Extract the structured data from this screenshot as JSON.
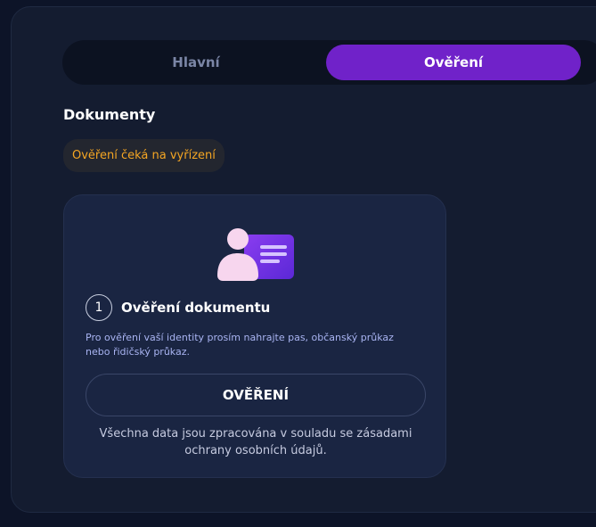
{
  "tabs": [
    {
      "label": "Hlavní",
      "active": false
    },
    {
      "label": "Ověření",
      "active": true
    }
  ],
  "section": {
    "title": "Dokumenty",
    "status_badge": "Ověření čeká na vyřízení"
  },
  "card": {
    "illustration_icon": "id-card-icon",
    "step_number": "1",
    "step_title": "Ověření dokumentu",
    "description_line1": "Pro ověření vaší identity prosím nahrajte pas, občanský průkaz",
    "description_line2": "nebo řidičský průkaz.",
    "button_label": "OVĚŘENÍ",
    "footnote_line1": "Všechna data jsou zpracována v souladu se zásadami",
    "footnote_line2": "ochrany osobních údajů."
  },
  "colors": {
    "accent": "#7022c9",
    "status": "#f5a623",
    "description": "#a9b4f2"
  }
}
